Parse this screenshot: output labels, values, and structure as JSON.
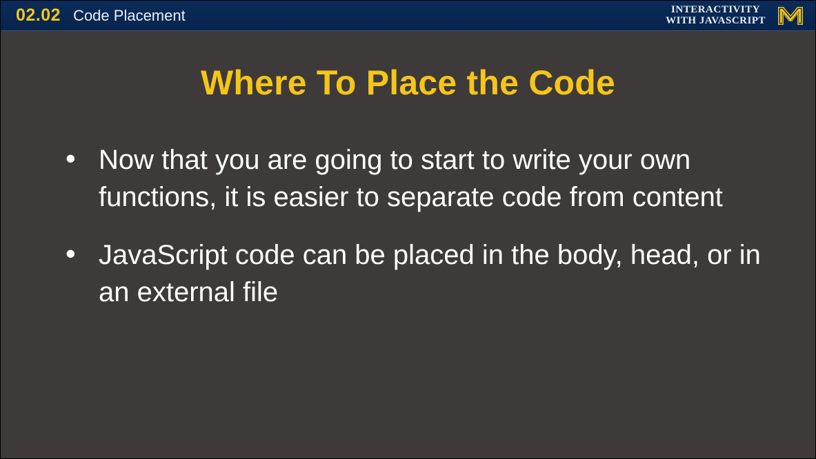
{
  "topbar": {
    "lesson_number": "02.02",
    "lesson_title": "Code Placement",
    "course_line1": "INTERACTIVITY",
    "course_line2": "WITH JAVASCRIPT"
  },
  "heading": "Where To Place the Code",
  "bullets": [
    "Now that you are going to start to write your own functions, it is easier to separate code from content",
    "JavaScript code can be placed in the body, head, or in an external file"
  ]
}
